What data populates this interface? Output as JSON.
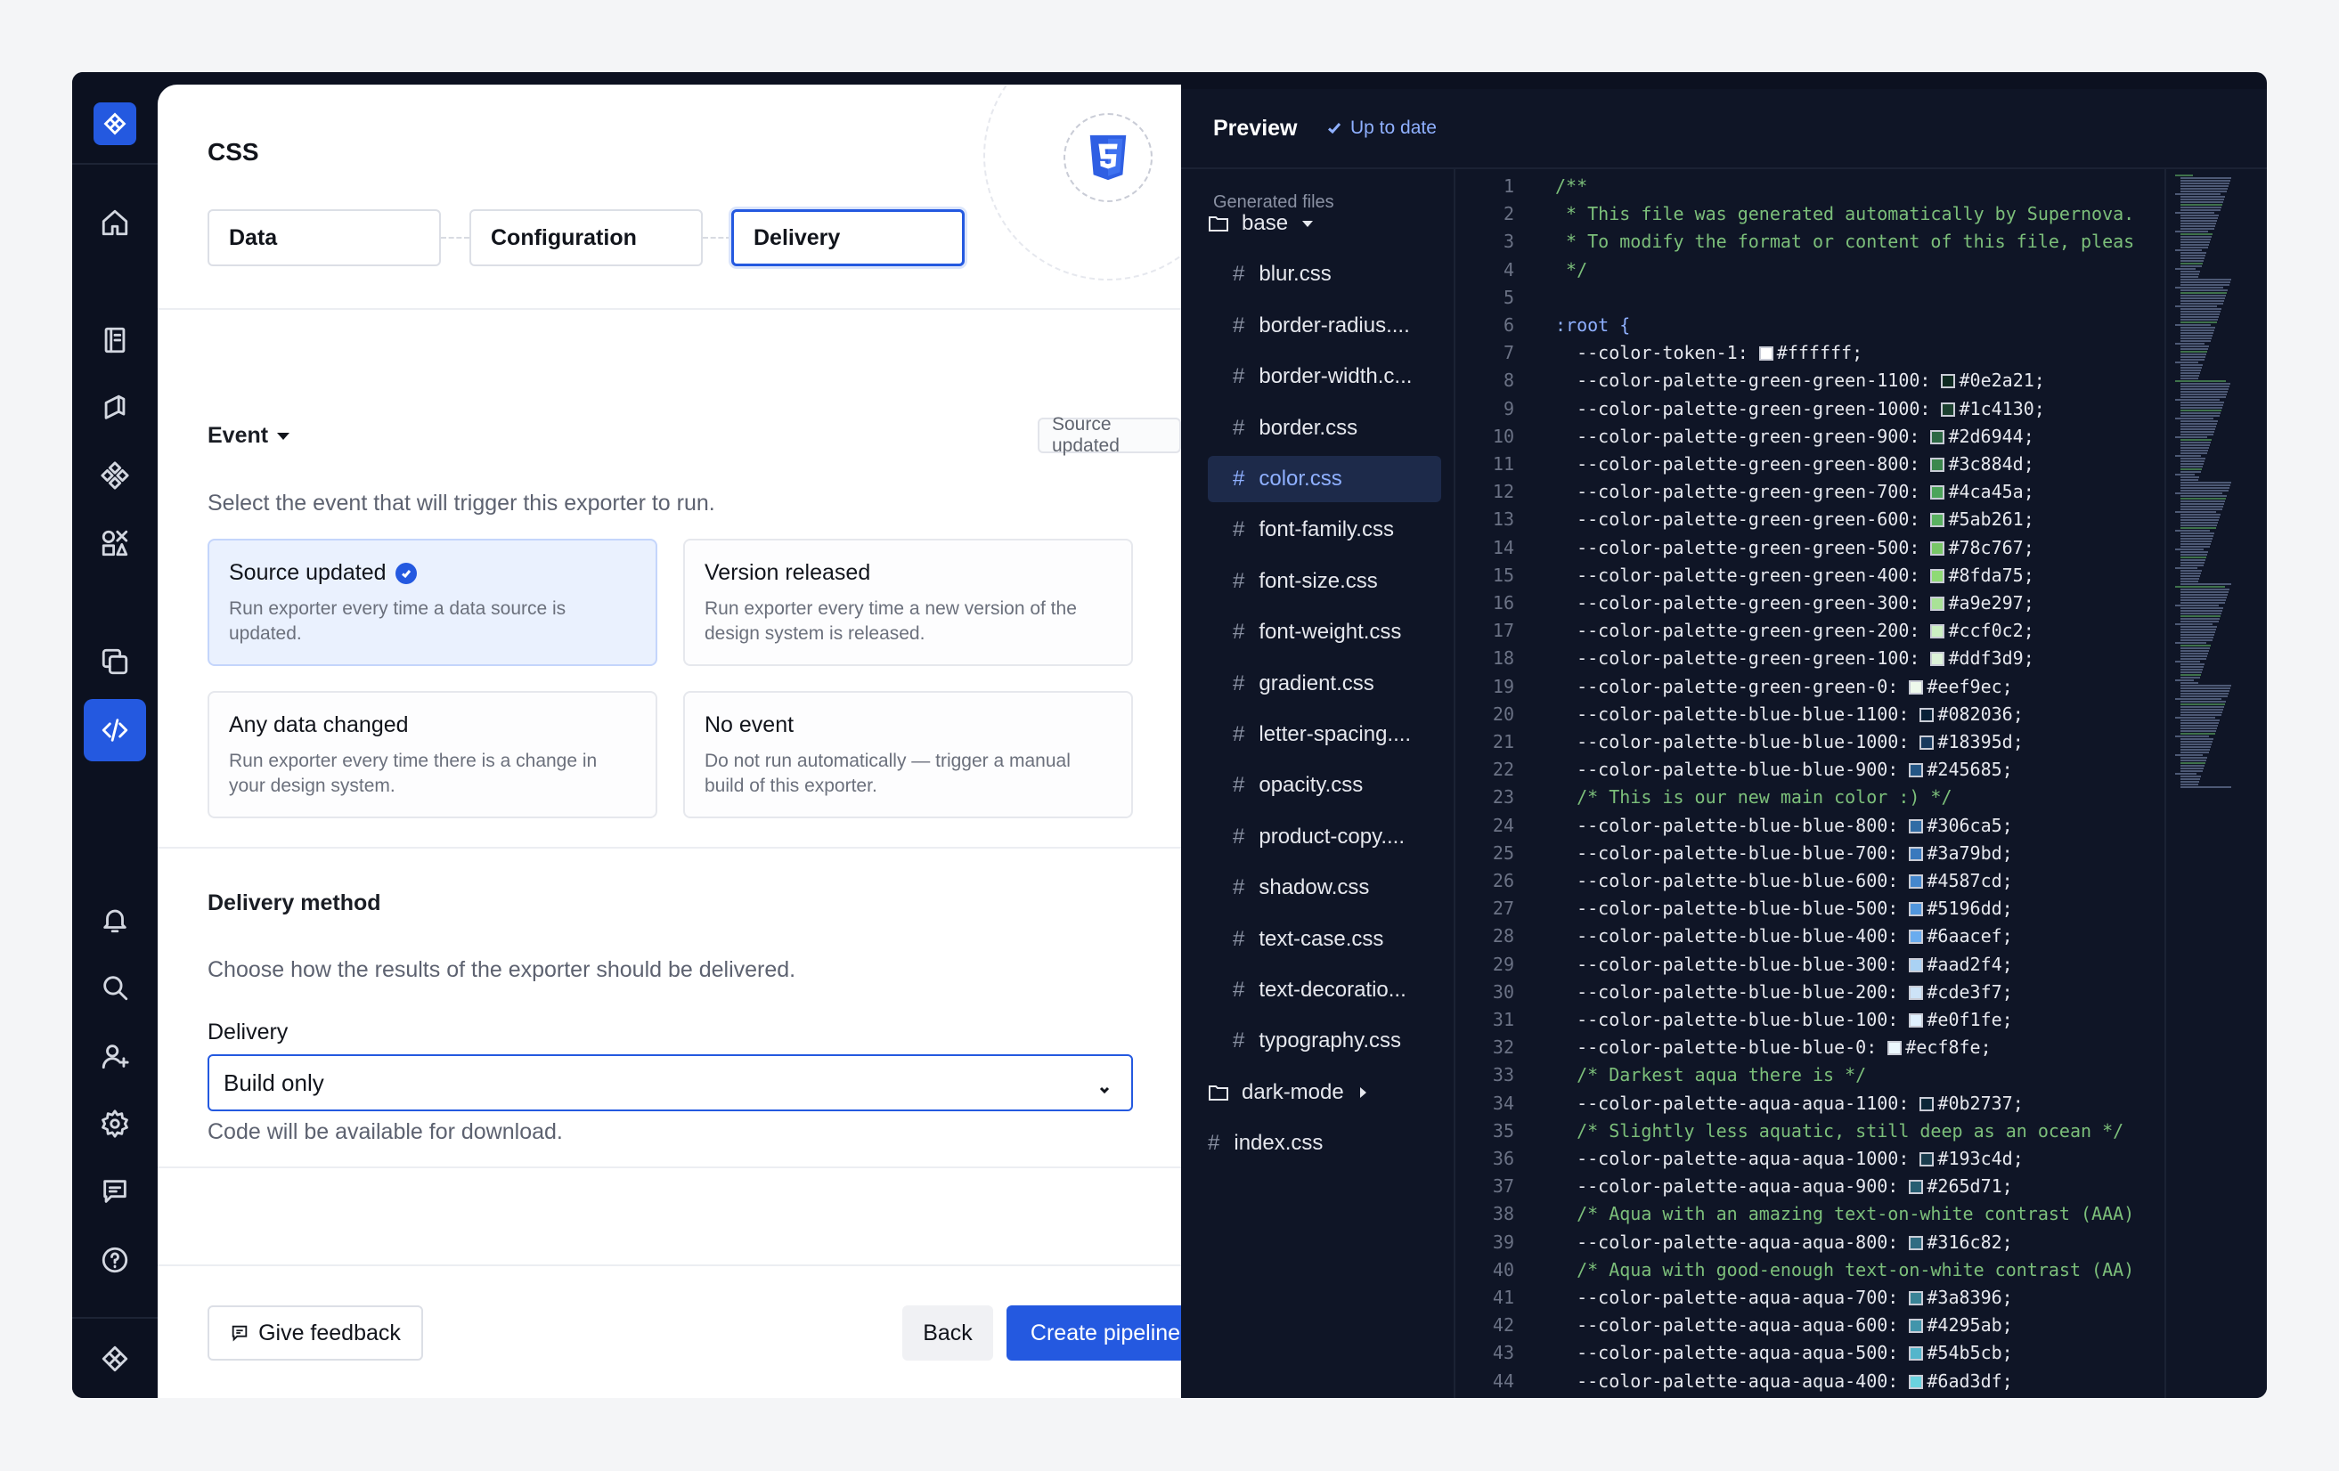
{
  "page": {
    "title": "CSS",
    "steps": [
      {
        "label": "Data"
      },
      {
        "label": "Configuration"
      },
      {
        "label": "Delivery"
      }
    ]
  },
  "event": {
    "title": "Event",
    "badge": "Source updated",
    "description": "Select the event that will trigger this exporter to run.",
    "options": [
      {
        "title": "Source updated",
        "sub": "Run exporter every time a data source is updated.",
        "selected": true
      },
      {
        "title": "Version released",
        "sub": "Run exporter every time a new version of the design system is released.",
        "selected": false
      },
      {
        "title": "Any data changed",
        "sub": "Run exporter every time there is a change in your design system.",
        "selected": false
      },
      {
        "title": "No event",
        "sub": "Do not run automatically — trigger a manual build of this exporter.",
        "selected": false
      }
    ]
  },
  "delivery": {
    "title": "Delivery method",
    "description": "Choose how the results of the exporter should be delivered.",
    "label": "Delivery",
    "selected": "Build only",
    "hint": "Code will be available for download."
  },
  "footer": {
    "feedback": "Give feedback",
    "back": "Back",
    "create": "Create pipeline"
  },
  "preview": {
    "title": "Preview",
    "status": "Up to date",
    "files_heading": "Generated files",
    "tree": [
      {
        "kind": "folder",
        "label": "base",
        "open": true
      },
      {
        "kind": "file",
        "label": "blur.css"
      },
      {
        "kind": "file",
        "label": "border-radius...."
      },
      {
        "kind": "file",
        "label": "border-width.c..."
      },
      {
        "kind": "file",
        "label": "border.css"
      },
      {
        "kind": "file",
        "label": "color.css",
        "selected": true
      },
      {
        "kind": "file",
        "label": "font-family.css"
      },
      {
        "kind": "file",
        "label": "font-size.css"
      },
      {
        "kind": "file",
        "label": "font-weight.css"
      },
      {
        "kind": "file",
        "label": "gradient.css"
      },
      {
        "kind": "file",
        "label": "letter-spacing...."
      },
      {
        "kind": "file",
        "label": "opacity.css"
      },
      {
        "kind": "file",
        "label": "product-copy...."
      },
      {
        "kind": "file",
        "label": "shadow.css"
      },
      {
        "kind": "file",
        "label": "text-case.css"
      },
      {
        "kind": "file",
        "label": "text-decoratio..."
      },
      {
        "kind": "file",
        "label": "typography.css"
      },
      {
        "kind": "folder",
        "label": "dark-mode",
        "open": false
      },
      {
        "kind": "root-file",
        "label": "index.css"
      }
    ],
    "code": [
      {
        "t": "/**",
        "k": "comment"
      },
      {
        "t": " * This file was generated automatically by Supernova.",
        "k": "comment"
      },
      {
        "t": " * To modify the format or content of this file, pleas",
        "k": "comment"
      },
      {
        "t": " */",
        "k": "comment"
      },
      {
        "t": "",
        "k": ""
      },
      {
        "t": ":root {",
        "k": "root"
      },
      {
        "t": "  --color-token-1: ",
        "c": "#ffffff",
        "v": "#ffffff;"
      },
      {
        "t": "  --color-palette-green-green-1100: ",
        "c": "#0e2a21",
        "v": "#0e2a21;"
      },
      {
        "t": "  --color-palette-green-green-1000: ",
        "c": "#1c4130",
        "v": "#1c4130;"
      },
      {
        "t": "  --color-palette-green-green-900: ",
        "c": "#2d6944",
        "v": "#2d6944;"
      },
      {
        "t": "  --color-palette-green-green-800: ",
        "c": "#3c884d",
        "v": "#3c884d;"
      },
      {
        "t": "  --color-palette-green-green-700: ",
        "c": "#4ca45a",
        "v": "#4ca45a;"
      },
      {
        "t": "  --color-palette-green-green-600: ",
        "c": "#5ab261",
        "v": "#5ab261;"
      },
      {
        "t": "  --color-palette-green-green-500: ",
        "c": "#78c767",
        "v": "#78c767;"
      },
      {
        "t": "  --color-palette-green-green-400: ",
        "c": "#8fda75",
        "v": "#8fda75;"
      },
      {
        "t": "  --color-palette-green-green-300: ",
        "c": "#a9e297",
        "v": "#a9e297;"
      },
      {
        "t": "  --color-palette-green-green-200: ",
        "c": "#ccf0c2",
        "v": "#ccf0c2;"
      },
      {
        "t": "  --color-palette-green-green-100: ",
        "c": "#ddf3d9",
        "v": "#ddf3d9;"
      },
      {
        "t": "  --color-palette-green-green-0: ",
        "c": "#eef9ec",
        "v": "#eef9ec;"
      },
      {
        "t": "  --color-palette-blue-blue-1100: ",
        "c": "#082036",
        "v": "#082036;"
      },
      {
        "t": "  --color-palette-blue-blue-1000: ",
        "c": "#18395d",
        "v": "#18395d;"
      },
      {
        "t": "  --color-palette-blue-blue-900: ",
        "c": "#245685",
        "v": "#245685;"
      },
      {
        "t": "  /* This is our new main color :) */",
        "k": "comment"
      },
      {
        "t": "  --color-palette-blue-blue-800: ",
        "c": "#306ca5",
        "v": "#306ca5;"
      },
      {
        "t": "  --color-palette-blue-blue-700: ",
        "c": "#3a79bd",
        "v": "#3a79bd;"
      },
      {
        "t": "  --color-palette-blue-blue-600: ",
        "c": "#4587cd",
        "v": "#4587cd;"
      },
      {
        "t": "  --color-palette-blue-blue-500: ",
        "c": "#5196dd",
        "v": "#5196dd;"
      },
      {
        "t": "  --color-palette-blue-blue-400: ",
        "c": "#6aacef",
        "v": "#6aacef;"
      },
      {
        "t": "  --color-palette-blue-blue-300: ",
        "c": "#aad2f4",
        "v": "#aad2f4;"
      },
      {
        "t": "  --color-palette-blue-blue-200: ",
        "c": "#cde3f7",
        "v": "#cde3f7;"
      },
      {
        "t": "  --color-palette-blue-blue-100: ",
        "c": "#e0f1fe",
        "v": "#e0f1fe;"
      },
      {
        "t": "  --color-palette-blue-blue-0: ",
        "c": "#ecf8fe",
        "v": "#ecf8fe;"
      },
      {
        "t": "  /* Darkest aqua there is */",
        "k": "comment"
      },
      {
        "t": "  --color-palette-aqua-aqua-1100: ",
        "c": "#0b2737",
        "v": "#0b2737;"
      },
      {
        "t": "  /* Slightly less aquatic, still deep as an ocean */",
        "k": "comment"
      },
      {
        "t": "  --color-palette-aqua-aqua-1000: ",
        "c": "#193c4d",
        "v": "#193c4d;"
      },
      {
        "t": "  --color-palette-aqua-aqua-900: ",
        "c": "#265d71",
        "v": "#265d71;"
      },
      {
        "t": "  /* Aqua with an amazing text-on-white contrast (AAA)",
        "k": "comment"
      },
      {
        "t": "  --color-palette-aqua-aqua-800: ",
        "c": "#316c82",
        "v": "#316c82;"
      },
      {
        "t": "  /* Aqua with good-enough text-on-white contrast (AA)",
        "k": "comment"
      },
      {
        "t": "  --color-palette-aqua-aqua-700: ",
        "c": "#3a8396",
        "v": "#3a8396;"
      },
      {
        "t": "  --color-palette-aqua-aqua-600: ",
        "c": "#4295ab",
        "v": "#4295ab;"
      },
      {
        "t": "  --color-palette-aqua-aqua-500: ",
        "c": "#54b5cb",
        "v": "#54b5cb;"
      },
      {
        "t": "  --color-palette-aqua-aqua-400: ",
        "c": "#6ad3df",
        "v": "#6ad3df;"
      }
    ]
  },
  "rail": {
    "icons": [
      "logo-icon",
      "home-icon",
      "book-icon",
      "docs-icon",
      "components-icon",
      "tokens-icon",
      "assets-icon",
      "code-icon",
      "bell-icon",
      "search-icon",
      "add-user-icon",
      "gear-icon",
      "chat-icon",
      "help-icon",
      "workspace-icon"
    ]
  },
  "colors": {
    "accent": "#2459e0",
    "panel_dark": "#0f1526",
    "comment": "#7cbf7a"
  }
}
